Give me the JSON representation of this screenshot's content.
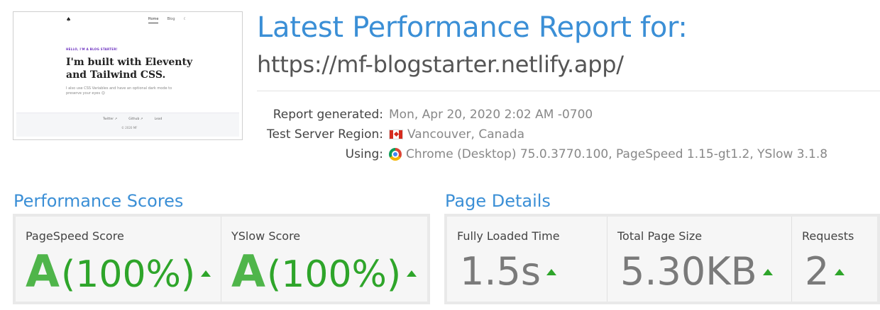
{
  "thumbnail": {
    "logo": "♠",
    "nav": [
      "Home",
      "Blog",
      "☾"
    ],
    "eyebrow": "HELLO, I'M A BLOG STARTER!",
    "headline": "I'm built with Eleventy and Tailwind CSS.",
    "sub": "I also use CSS Variables and have an optional dark mode to preserve your eyes 😉",
    "footer_links": [
      "Twitter ↗",
      "Github ↗",
      "Lead"
    ],
    "copyright": "© 2020 MF"
  },
  "header": {
    "title": "Latest Performance Report for:",
    "url": "https://mf-blogstarter.netlify.app/"
  },
  "meta": {
    "report_generated_label": "Report generated:",
    "report_generated_value": "Mon, Apr 20, 2020 2:02 AM -0700",
    "region_label": "Test Server Region:",
    "region_value": "Vancouver, Canada",
    "using_label": "Using:",
    "using_value": "Chrome (Desktop) 75.0.3770.100, PageSpeed 1.15-gt1.2, YSlow 3.1.8"
  },
  "performance": {
    "title": "Performance Scores",
    "pagespeed": {
      "label": "PageSpeed Score",
      "grade": "A",
      "percent": "(100%)"
    },
    "yslow": {
      "label": "YSlow Score",
      "grade": "A",
      "percent": "(100%)"
    }
  },
  "details": {
    "title": "Page Details",
    "loaded": {
      "label": "Fully Loaded Time",
      "value": "1.5s"
    },
    "size": {
      "label": "Total Page Size",
      "value": "5.30KB"
    },
    "requests": {
      "label": "Requests",
      "value": "2"
    }
  },
  "colors": {
    "accent": "#3b8fd6",
    "grade_green": "#2ea52a",
    "caret": "#2ea52a"
  }
}
